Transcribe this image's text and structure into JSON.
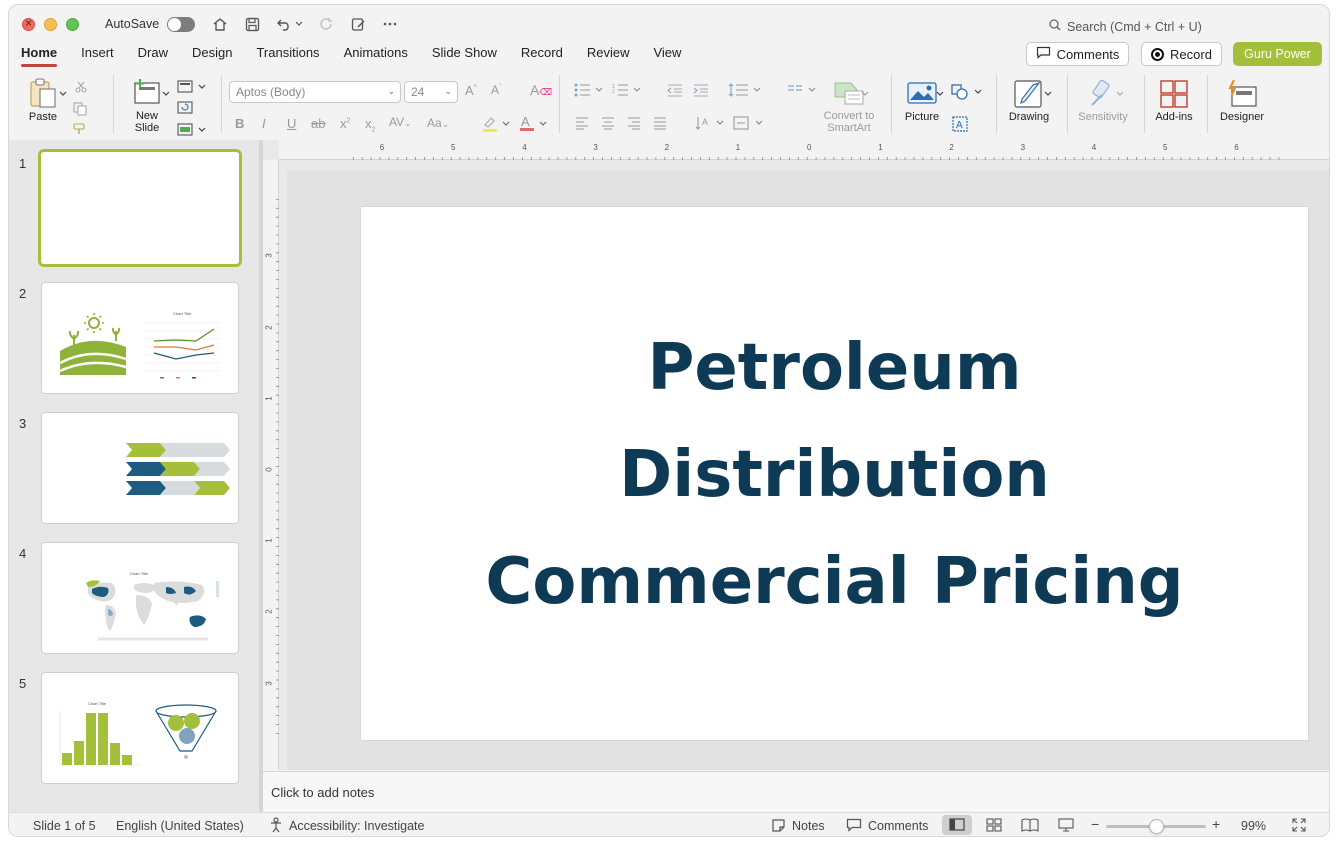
{
  "titlebar": {
    "autosave_label": "AutoSave",
    "search_placeholder": "Search (Cmd + Ctrl + U)"
  },
  "tabs": [
    "Home",
    "Insert",
    "Draw",
    "Design",
    "Transitions",
    "Animations",
    "Slide Show",
    "Record",
    "Review",
    "View"
  ],
  "active_tab": "Home",
  "header_buttons": {
    "comments": "Comments",
    "record": "Record",
    "guru": "Guru Power"
  },
  "ribbon": {
    "paste": "Paste",
    "new_slide_line1": "New",
    "new_slide_line2": "Slide",
    "font_name": "Aptos (Body)",
    "font_size": "24",
    "convert_line1": "Convert to",
    "convert_line2": "SmartArt",
    "picture": "Picture",
    "drawing": "Drawing",
    "sensitivity": "Sensitivity",
    "addins": "Add-ins",
    "designer": "Designer"
  },
  "slides": [
    {
      "num": "1"
    },
    {
      "num": "2"
    },
    {
      "num": "3"
    },
    {
      "num": "4"
    },
    {
      "num": "5"
    }
  ],
  "thumb_labels": {
    "chart_title": "Chart Title"
  },
  "slide": {
    "line1": "Petroleum",
    "line2": "Distribution",
    "line3": "Commercial Pricing"
  },
  "rulers": {
    "h": [
      "6",
      "5",
      "4",
      "3",
      "2",
      "1",
      "0",
      "1",
      "2",
      "3",
      "4",
      "5",
      "6"
    ],
    "v": [
      "3",
      "2",
      "1",
      "0",
      "1",
      "2",
      "3"
    ]
  },
  "notes_placeholder": "Click to add notes",
  "status": {
    "slide_count": "Slide 1 of 5",
    "language": "English (United States)",
    "accessibility": "Accessibility: Investigate",
    "notes": "Notes",
    "comments": "Comments",
    "zoom": "99%"
  },
  "colors": {
    "accent_green": "#a4c03a",
    "title_navy": "#0f3a55",
    "dark_blue": "#1d5c80"
  }
}
